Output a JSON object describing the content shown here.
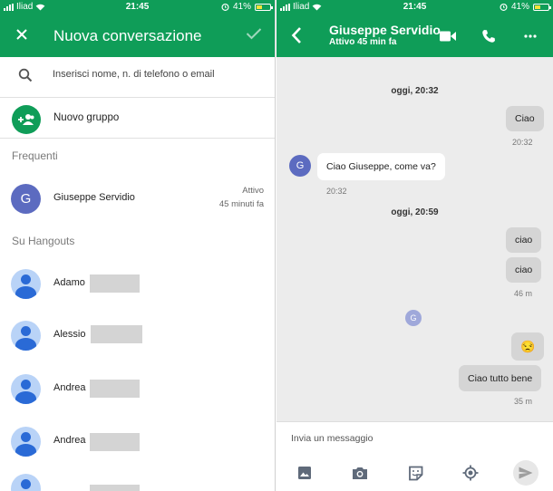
{
  "status": {
    "left": {
      "carrier": "Iliad",
      "time": "21:45",
      "battery": "41%"
    },
    "right": {
      "carrier": "Iliad",
      "time": "21:45",
      "battery": "41%"
    }
  },
  "new_conversation": {
    "title": "Nuova conversazione",
    "close_icon": "close-icon",
    "confirm_icon": "check-icon",
    "search": {
      "placeholder": "Inserisci nome, n. di telefono o email",
      "value": ""
    },
    "new_group_label": "Nuovo gruppo",
    "frequent_title": "Frequenti",
    "frequent": [
      {
        "initial": "G",
        "name": "Giuseppe Servidio",
        "status_line1": "Attivo",
        "status_line2": "45 minuti fa"
      }
    ],
    "hangouts_title": "Su Hangouts",
    "hangouts_contacts": [
      {
        "name": "Adamo"
      },
      {
        "name": "Alessio"
      },
      {
        "name": "Andrea"
      },
      {
        "name": "Andrea"
      }
    ]
  },
  "conversation": {
    "contact_name": "Giuseppe Servidio",
    "contact_status": "Attivo 45 min fa",
    "icons": [
      "back-icon",
      "video-call-icon",
      "phone-icon",
      "more-icon"
    ],
    "contact_initial": "G",
    "messages": [
      {
        "type": "day",
        "text": "oggi, 20:32"
      },
      {
        "type": "out",
        "text": "Ciao",
        "time": "20:32"
      },
      {
        "type": "in",
        "text": "Ciao Giuseppe, come va?",
        "time": "20:32"
      },
      {
        "type": "day",
        "text": "oggi, 20:59"
      },
      {
        "type": "out",
        "text": "ciao"
      },
      {
        "type": "out",
        "text": "ciao",
        "time": "46 m"
      },
      {
        "type": "read_receipt",
        "initial": "G"
      },
      {
        "type": "out",
        "text": "😒"
      },
      {
        "type": "out",
        "text": "Ciao tutto bene",
        "time": "35 m"
      }
    ],
    "composer": {
      "placeholder": "Invia un messaggio",
      "value": "",
      "tools": [
        "image-icon",
        "camera-icon",
        "sticker-icon",
        "location-icon",
        "send-icon"
      ]
    }
  },
  "colors": {
    "accent": "#0f9d58",
    "avatar": "#5c6bc0",
    "generic_avatar": "#2a6ad6"
  }
}
